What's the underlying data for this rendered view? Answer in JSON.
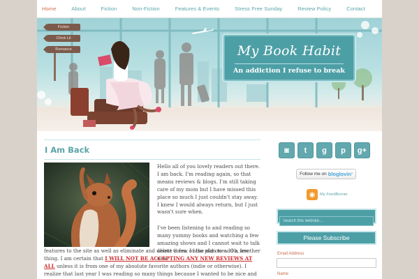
{
  "nav": {
    "items": [
      {
        "label": "Home",
        "active": true
      },
      {
        "label": "About"
      },
      {
        "label": "Fiction"
      },
      {
        "label": "Non-Fiction"
      },
      {
        "label": "Features & Events"
      },
      {
        "label": "Stress Free Sunday"
      },
      {
        "label": "Review Policy"
      },
      {
        "label": "Contact"
      }
    ]
  },
  "header": {
    "title": "My Book Habit",
    "tagline": "An addiction I refuse to break",
    "signs": [
      "Fiction",
      "Chick Lit",
      "Romance"
    ]
  },
  "post": {
    "title": "I Am Back",
    "image_icon": "squirrel-photo",
    "para1": "Hello all of you lovely readers out there. I am back. I'm reading again, so that means reviews & blogs. I'm still taking care of my mom but I have missed this place so much I just couldn't stay away. I knew I would always return, but I just wasn't sure when.",
    "para2a": "I've been listening to and reading so many yummy books and watching a few amazing shows and I cannot wait to talk about them. I also plan to add a few new",
    "para2b_start": "features to the site as well as eliminate and delete a few of the old ones. Oh, another thing. I am certain that ",
    "para2b_warning": "I WILL NOT BE ACCEPTING ANY NEW REVIEWS AT ALL",
    "para2b_end": " unless it is from one of my absolute favorite authors (indie or otherwise). I realize that last year I was reading so many things because I wanted to be nice and not hurt feelings, but I found that was not an"
  },
  "sidebar": {
    "social": [
      {
        "icon": "instagram-icon",
        "glyph": "◙"
      },
      {
        "icon": "twitter-icon",
        "glyph": "t"
      },
      {
        "icon": "goodreads-icon",
        "glyph": "g"
      },
      {
        "icon": "pinterest-icon",
        "glyph": "p"
      },
      {
        "icon": "google-plus-icon",
        "glyph": "g+"
      }
    ],
    "bloglovin_prefix": "Follow me on",
    "bloglovin_brand": "bloglovin'",
    "feed_label": "My FeedBurner",
    "search_placeholder": "Search this website…",
    "subscribe_label": "Please Subscribe",
    "email_label": "Email Address",
    "name_label": "Name"
  },
  "colors": {
    "accent": "#5aa4a8",
    "banner": "#4d9fa6",
    "active_nav": "#d26d4a",
    "warning": "#cc2b2b"
  }
}
